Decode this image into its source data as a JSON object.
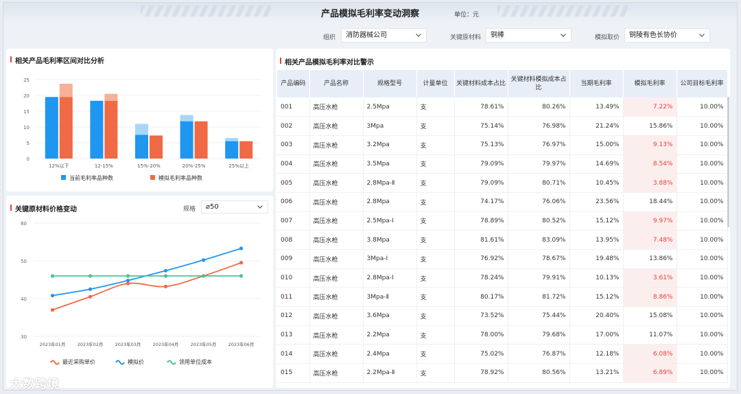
{
  "header": {
    "title": "产品模拟毛利率变动洞察",
    "unit": "单位：元"
  },
  "filters": [
    {
      "label": "组织",
      "value": "消防器械公司"
    },
    {
      "label": "关键原材料",
      "value": "铜棒"
    },
    {
      "label": "模拟取价",
      "value": "铜陵有色长协价"
    }
  ],
  "left_top": {
    "title": "相关产品毛利率区间对比分析",
    "legend": [
      "当前毛利率品种数",
      "模拟毛利率品种数"
    ]
  },
  "left_bottom": {
    "title": "关键原材料价格变动",
    "spec_label": "规格",
    "spec_value": "⌀50",
    "legend": [
      "最近采购单价",
      "模拟价",
      "领用单位成本"
    ]
  },
  "right": {
    "title": "相关产品模拟毛利率对比警示",
    "columns": [
      "产品编码",
      "产品名称",
      "规格型号",
      "计量单位",
      "关键材料成本占比",
      "关键材料模拟成本占比",
      "当期毛利率",
      "模拟毛利率",
      "公司目标毛利率"
    ],
    "rows": [
      [
        "001",
        "高压水枪",
        "2.5Mpa",
        "支",
        "78.61%",
        "80.26%",
        "13.49%",
        "7.22%",
        "10.00%"
      ],
      [
        "002",
        "高压水枪",
        "3Mpa",
        "支",
        "75.14%",
        "76.98%",
        "21.24%",
        "15.86%",
        "10.00%"
      ],
      [
        "003",
        "高压水枪",
        "3.2Mpa",
        "支",
        "75.13%",
        "76.97%",
        "15.00%",
        "9.13%",
        "10.00%"
      ],
      [
        "004",
        "高压水枪",
        "3.5Mpa",
        "支",
        "79.09%",
        "79.97%",
        "14.69%",
        "8.54%",
        "10.00%"
      ],
      [
        "005",
        "高压水枪",
        "2.8Mpa-Ⅱ",
        "支",
        "79.09%",
        "80.71%",
        "10.45%",
        "3.88%",
        "10.00%"
      ],
      [
        "006",
        "高压水枪",
        "2.8Mpa",
        "支",
        "74.17%",
        "76.06%",
        "23.56%",
        "18.44%",
        "10.00%"
      ],
      [
        "007",
        "高压水枪",
        "2.5Mpa-Ⅰ",
        "支",
        "78.89%",
        "80.52%",
        "15.12%",
        "9.97%",
        "10.00%"
      ],
      [
        "008",
        "高压水枪",
        "3.8Mpa",
        "支",
        "81.61%",
        "83.09%",
        "13.95%",
        "7.48%",
        "10.00%"
      ],
      [
        "009",
        "高压水枪",
        "3Mpa-Ⅰ",
        "支",
        "76.92%",
        "78.67%",
        "19.48%",
        "13.86%",
        "10.00%"
      ],
      [
        "010",
        "高压水枪",
        "2.8Mpa-Ⅰ",
        "支",
        "78.24%",
        "79.91%",
        "10.13%",
        "3.61%",
        "10.00%"
      ],
      [
        "011",
        "高压水枪",
        "3Mpa-Ⅱ",
        "支",
        "80.17%",
        "81.72%",
        "15.12%",
        "8.86%",
        "10.00%"
      ],
      [
        "012",
        "高压水枪",
        "3.6Mpa",
        "支",
        "73.52%",
        "75.44%",
        "20.40%",
        "15.08%",
        "10.00%"
      ],
      [
        "013",
        "高压水枪",
        "2.2Mpa",
        "支",
        "78.00%",
        "79.68%",
        "17.00%",
        "11.07%",
        "10.00%"
      ],
      [
        "014",
        "高压水枪",
        "2.4Mpa",
        "支",
        "75.02%",
        "76.87%",
        "12.18%",
        "6.08%",
        "10.00%"
      ],
      [
        "015",
        "高压水枪",
        "2.2Mpa-Ⅱ",
        "支",
        "78.92%",
        "80.56%",
        "13.21%",
        "6.89%",
        "10.00%"
      ]
    ]
  },
  "watermark": "大数跨境",
  "colors": {
    "blue": "#1f96f0",
    "blue_light": "#a9d6f7",
    "orange": "#ef6a45",
    "orange_light": "#f6b196",
    "green": "#4cc294",
    "warn": "#e2403b"
  },
  "chart_data": [
    {
      "type": "bar",
      "title": "相关产品毛利率区间对比分析",
      "categories": [
        "12%以下",
        "12-15%",
        "15%-20%",
        "20%-25%",
        "25%以上"
      ],
      "series": [
        {
          "name": "当前毛利率品种数",
          "values": [
            19.5,
            18.3,
            7.5,
            11.8,
            5.5
          ],
          "overlay": [
            19.5,
            18.3,
            11,
            13.8,
            6.5
          ]
        },
        {
          "name": "模拟毛利率品种数",
          "values": [
            19.5,
            18.3,
            7.3,
            11.8,
            5.5
          ],
          "overlay": [
            23.7,
            20.5,
            7.3,
            11.8,
            5.5
          ]
        }
      ],
      "ylim": [
        0,
        25
      ],
      "yticks": [
        0,
        5,
        10,
        15,
        20,
        25
      ],
      "grid": true,
      "legend": "bottom"
    },
    {
      "type": "line",
      "title": "关键原材料价格变动",
      "x": [
        "2023年01月",
        "2023年02月",
        "2023年03月",
        "2023年04月",
        "2023年05月",
        "2023年06月"
      ],
      "series": [
        {
          "name": "最近采购单价",
          "values": [
            37,
            40.5,
            44,
            43.2,
            46,
            49.5
          ]
        },
        {
          "name": "模拟价",
          "values": [
            40.8,
            42.5,
            44.8,
            47.4,
            50.2,
            53.3
          ]
        },
        {
          "name": "领用单位成本",
          "values": [
            46,
            46,
            46,
            46,
            46,
            46
          ]
        }
      ],
      "ylim": [
        30,
        60
      ],
      "yticks": [
        30,
        40,
        50,
        60
      ],
      "grid": true,
      "legend": "bottom"
    }
  ]
}
